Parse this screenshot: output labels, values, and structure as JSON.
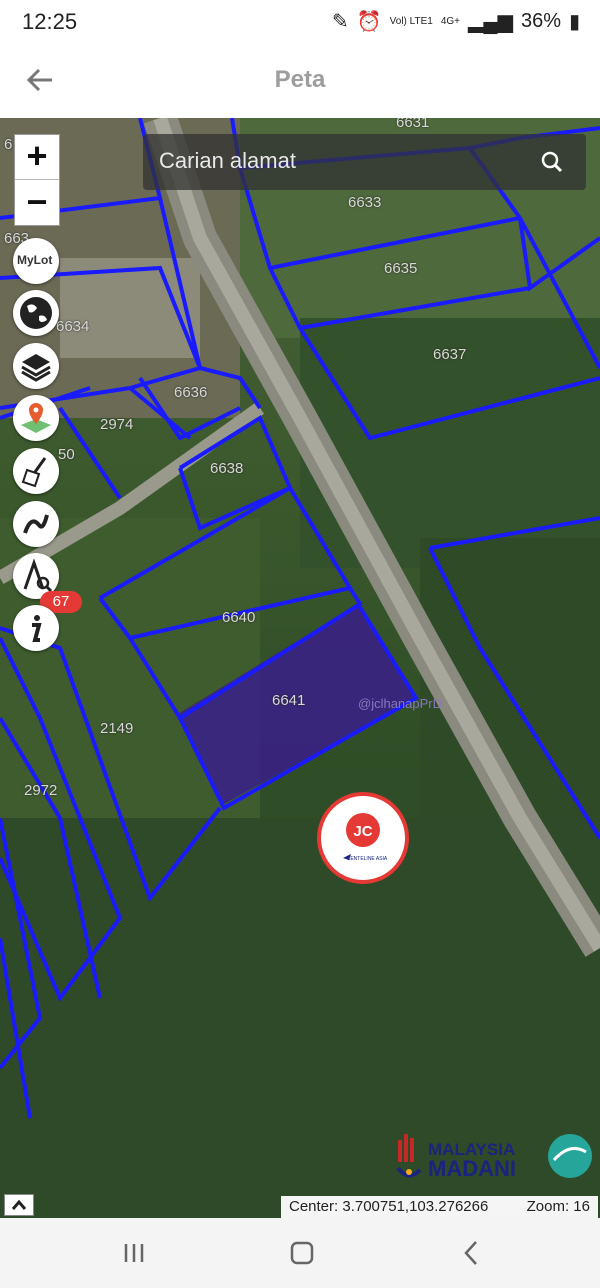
{
  "status": {
    "time": "12:25",
    "volte": "Vol) LTE1",
    "network": "4G+",
    "battery": "36%"
  },
  "app_bar": {
    "title": "Peta"
  },
  "search": {
    "placeholder": "Carian alamat"
  },
  "map": {
    "parcels": [
      "6631",
      "6633",
      "6635",
      "6637",
      "6634",
      "6636",
      "2974",
      "6638",
      "6640",
      "6641",
      "2149",
      "2972"
    ],
    "partial_labels": [
      "6",
      "663",
      "50"
    ],
    "badge_count": "67",
    "watermark": "@jclhanapPrD"
  },
  "tools": [
    "zoom-in",
    "zoom-out",
    "mylot",
    "globe",
    "layers",
    "location-map",
    "broom",
    "path",
    "measure",
    "info"
  ],
  "mylot_label": "MyLot",
  "logo": {
    "jc_text": "JC",
    "brand": "CENTELINE ASIA",
    "madani_line1": "MALAYSIA",
    "madani_line2": "MADANI"
  },
  "info": {
    "center": "Center: 3.700751,103.276266",
    "zoom": "Zoom: 16"
  },
  "colors": {
    "parcel_line": "#1a1aff",
    "highlight": "#3a1f8a",
    "badge": "#e53935"
  }
}
